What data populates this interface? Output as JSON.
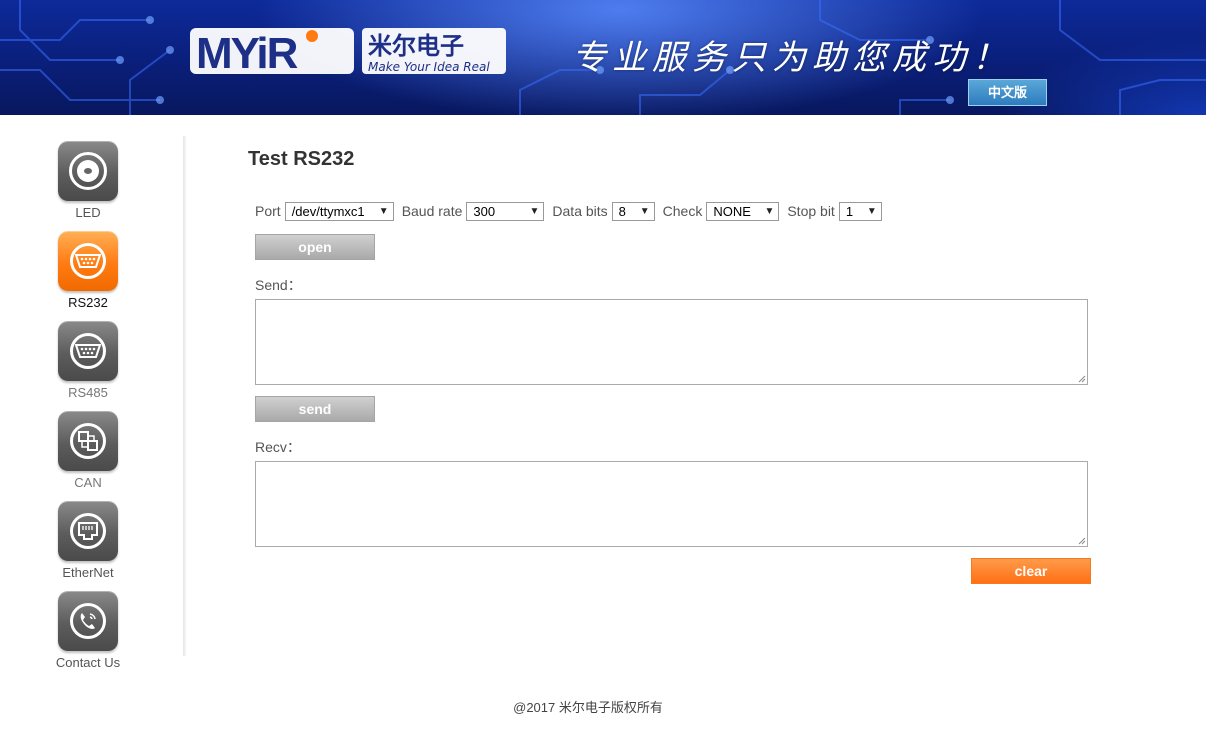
{
  "header": {
    "logo_text": "MYiR",
    "logo_cn": "米尔电子",
    "logo_tagline": "Make Your Idea Real",
    "slogan": "专业服务只为助您成功！",
    "lang_button": "中文版",
    "colors": {
      "banner": "#0a1f7a",
      "lang_button": "#3d8dc9"
    }
  },
  "sidebar": {
    "items": [
      {
        "label": "LED",
        "icon": "led-icon",
        "active": false
      },
      {
        "label": "RS232",
        "icon": "serial-port-icon",
        "active": true
      },
      {
        "label": "RS485",
        "icon": "serial-port-icon",
        "active": false
      },
      {
        "label": "CAN",
        "icon": "can-bus-icon",
        "active": false
      },
      {
        "label": "EtherNet",
        "icon": "ethernet-port-icon",
        "active": false
      },
      {
        "label": "Contact Us",
        "icon": "phone-icon",
        "active": false
      }
    ],
    "colors": {
      "active": "#ff7b12",
      "inactive": "#5c5c5c"
    }
  },
  "main": {
    "title": "Test RS232",
    "settings": {
      "port": {
        "label": "Port",
        "value": "/dev/ttymxc1"
      },
      "baud": {
        "label": "Baud rate",
        "value": "300"
      },
      "data_bits": {
        "label": "Data bits",
        "value": "8"
      },
      "check": {
        "label": "Check",
        "value": "NONE"
      },
      "stop_bit": {
        "label": "Stop bit",
        "value": "1"
      }
    },
    "open_button": "open",
    "send_label": "Send：",
    "send_value": "",
    "send_button": "send",
    "recv_label": "Recv：",
    "recv_value": "",
    "clear_button": "clear",
    "colors": {
      "accent": "#ff7b12",
      "gray_button": "#a9a9a9"
    }
  },
  "footer": {
    "text": "@2017 米尔电子版权所有"
  }
}
